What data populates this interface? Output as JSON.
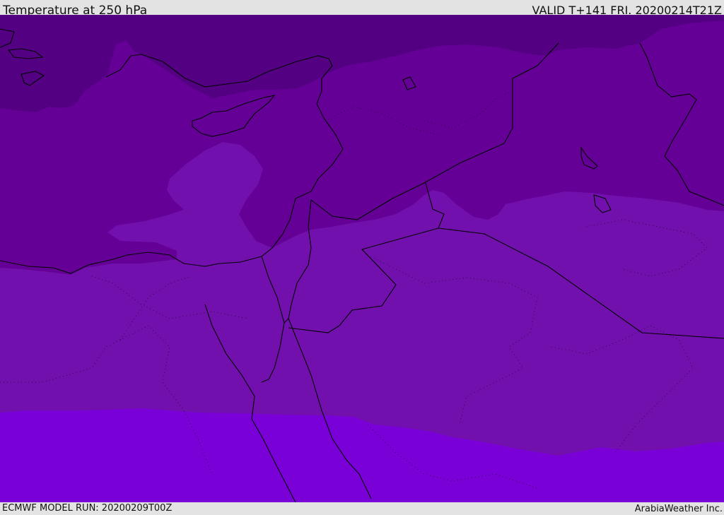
{
  "header": {
    "title": "Temperature at 250 hPa",
    "valid_time": "VALID T+141 FRI. 20200214T21Z"
  },
  "footer": {
    "model_run": "ECMWF MODEL RUN: 20200209T00Z",
    "credit": "ArabiaWeather Inc."
  },
  "map": {
    "variable": "Temperature",
    "level": "250 hPa",
    "bands": [
      {
        "name": "coldest-band",
        "color": "#540083"
      },
      {
        "name": "cold-band",
        "color": "#650096"
      },
      {
        "name": "mid-band",
        "color": "#7210ad"
      },
      {
        "name": "warm-band",
        "color": "#7a00d8"
      }
    ],
    "boundary_color": "#000000"
  }
}
